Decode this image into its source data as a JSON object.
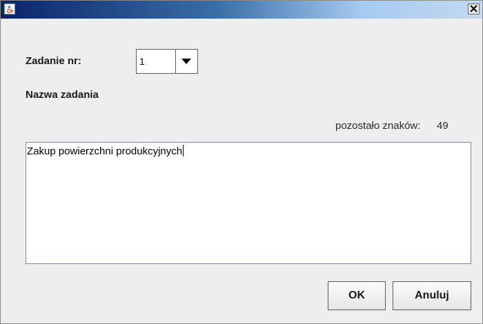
{
  "window": {
    "title": "",
    "close_label": "×"
  },
  "task": {
    "number_label": "Zadanie nr:",
    "number_value": "1",
    "name_label": "Nazwa zadania"
  },
  "counter": {
    "label": "pozostało znaków:",
    "value": "49"
  },
  "editor": {
    "text": "Zakup powierzchni produkcyjnych"
  },
  "buttons": {
    "ok": "OK",
    "cancel": "Anuluj"
  },
  "icons": {
    "app": "java-coffee-icon",
    "close": "close-icon",
    "dropdown": "chevron-down-icon"
  }
}
